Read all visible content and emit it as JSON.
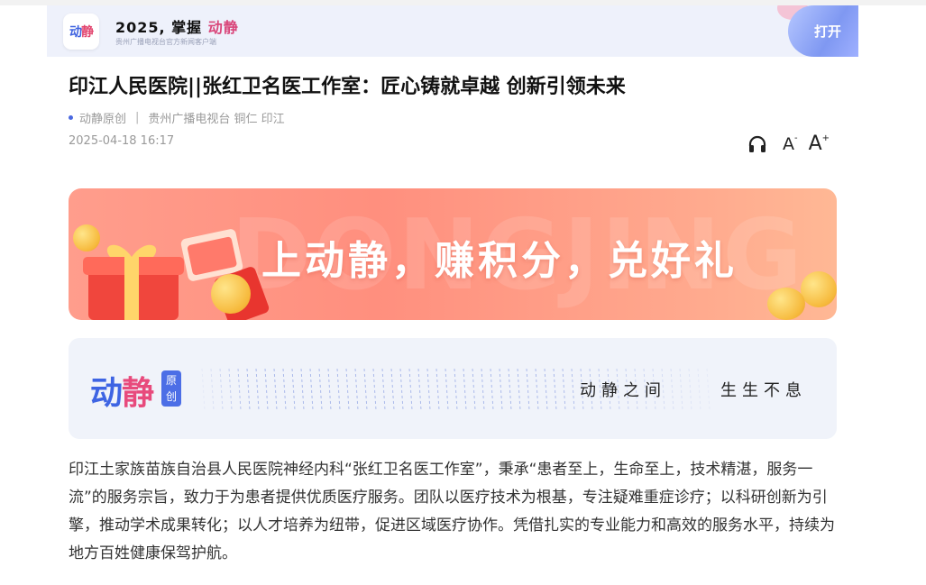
{
  "app_banner": {
    "logo_text_a": "动",
    "logo_text_b": "静",
    "slogan_prefix": "2025, 掌握",
    "slogan_brand": "动静",
    "subtitle": "贵州广播电视台官方新闻客户端",
    "open_button": "打开"
  },
  "article": {
    "title": "印江人民医院||张红卫名医工作室：匠心铸就卓越 创新引领未来",
    "source_tag": "动静原创",
    "separator": "|",
    "source_detail": "贵州广播电视台 铜仁 印江",
    "date": "2025-04-18 16:17",
    "paragraph": "印江土家族苗族自治县人民医院神经内科“张红卫名医工作室”，秉承“患者至上，生命至上，技术精湛，服务一流”的服务宗旨，致力于为患者提供优质医疗服务。团队以医疗技术为根基，专注疑难重症诊疗；以科研创新为引擎，推动学术成果转化；以人才培养为纽带，促进区域医疗协作。凭借扎实的专业能力和高效的服务水平，持续为地方百姓健康保驾护航。"
  },
  "toolbar": {
    "font_small": "A",
    "font_small_mark": "-",
    "font_large": "A",
    "font_large_mark": "+"
  },
  "icons": {
    "listen": "headphones-icon",
    "font_decrease": "font-decrease-icon",
    "font_increase": "font-increase-icon"
  },
  "promo": {
    "watermark": "DONGJING",
    "text": "上动静，赚积分，兑好礼"
  },
  "brand_card": {
    "logo_a": "动",
    "logo_b": "静",
    "tag": "原创",
    "motto_1": "动静之间",
    "motto_2": "生生不息"
  },
  "colors": {
    "brand_blue": "#3e64e3",
    "brand_pink": "#e84a7c",
    "promo_bg": "#ff9d8c"
  }
}
